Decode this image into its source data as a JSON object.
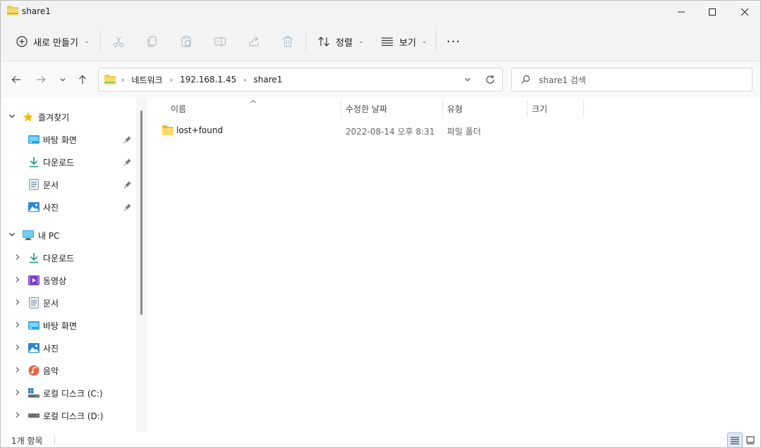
{
  "window": {
    "title": "share1",
    "icons": {
      "folder": "folder-icon",
      "minimize": "minimize-icon",
      "maximize": "maximize-icon",
      "close": "close-icon"
    }
  },
  "toolbar": {
    "new_label": "새로 만들기",
    "sort_label": "정렬",
    "view_label": "보기",
    "more_label": "···",
    "icons": [
      "cut-icon",
      "copy-icon",
      "paste-icon",
      "rename-icon",
      "share-icon",
      "delete-icon"
    ]
  },
  "navigation": {
    "breadcrumb": [
      "네트워크",
      "192.168.1.45",
      "share1"
    ],
    "search_placeholder": "share1 검색"
  },
  "sidebar": {
    "quick_access": {
      "label": "즐겨찾기",
      "items": [
        {
          "label": "바탕 화면",
          "icon": "desktop-icon",
          "pinned": true
        },
        {
          "label": "다운로드",
          "icon": "download-icon",
          "pinned": true
        },
        {
          "label": "문서",
          "icon": "document-icon",
          "pinned": true
        },
        {
          "label": "사진",
          "icon": "pictures-icon",
          "pinned": true
        }
      ]
    },
    "this_pc": {
      "label": "내 PC",
      "items": [
        {
          "label": "다운로드",
          "icon": "download-icon"
        },
        {
          "label": "동영상",
          "icon": "video-icon"
        },
        {
          "label": "문서",
          "icon": "document-icon"
        },
        {
          "label": "바탕 화면",
          "icon": "desktop-icon"
        },
        {
          "label": "사진",
          "icon": "pictures-icon"
        },
        {
          "label": "음악",
          "icon": "music-icon"
        },
        {
          "label": "로컬 디스크 (C:)",
          "icon": "windows-drive-icon"
        },
        {
          "label": "로컬 디스크 (D:)",
          "icon": "drive-icon"
        }
      ]
    }
  },
  "file_list": {
    "columns": [
      "이름",
      "수정한 날짜",
      "유형",
      "크기"
    ],
    "rows": [
      {
        "name": "lost+found",
        "modified": "2022-08-14 오후 8:31",
        "type": "파일 폴더",
        "size": ""
      }
    ]
  },
  "status": {
    "item_count": "1개 항목"
  },
  "colors": {
    "folder_yellow": "#f2c94c",
    "accent_blue": "#0067c0",
    "star_gold": "#f5b800",
    "download_green": "#1a9f6d"
  }
}
